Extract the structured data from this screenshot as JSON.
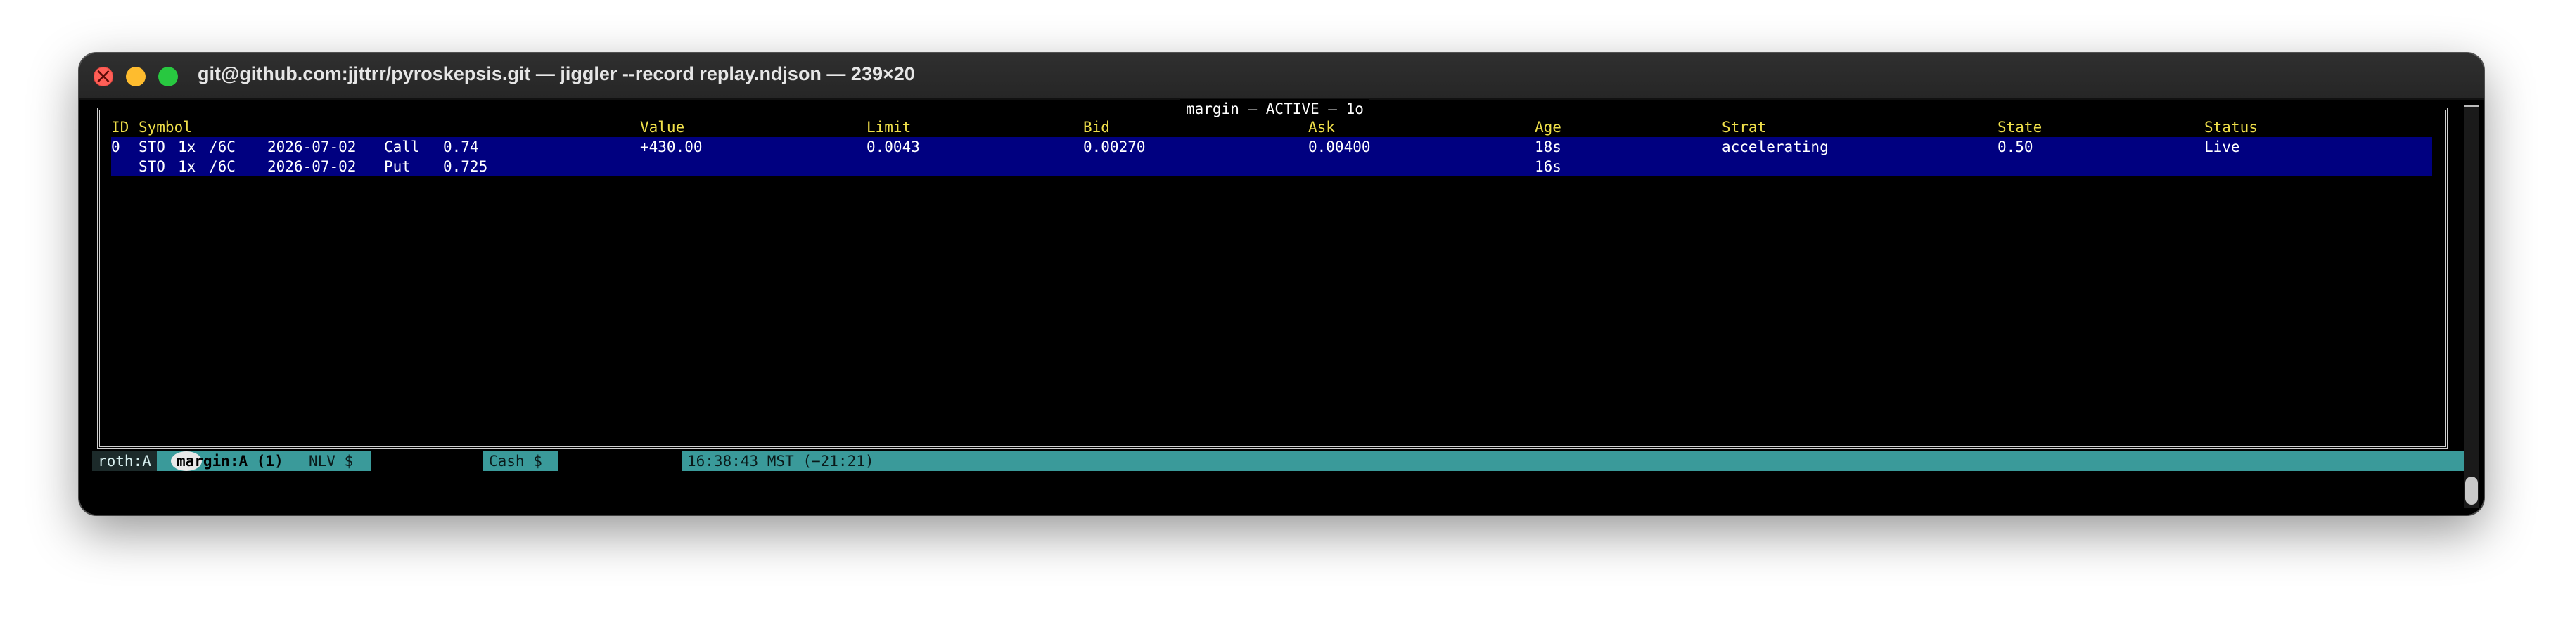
{
  "window": {
    "title": "git@github.com:jjttrr/pyroskepsis.git — jiggler --record replay.ndjson — 239×20"
  },
  "panel": {
    "title": "margin — ACTIVE — 1o"
  },
  "table": {
    "headers": [
      "ID",
      "Symbol",
      "Value",
      "Limit",
      "Bid",
      "Ask",
      "Age",
      "Strat",
      "State",
      "Status"
    ],
    "rows": [
      {
        "id": "0",
        "side": "STO",
        "qty": "1x",
        "root": "/6C",
        "expiry": "2026-07-02",
        "type": "Call",
        "strike": "0.74",
        "value": "+430.00",
        "limit": "0.0043",
        "bid": "0.00270",
        "ask": "0.00400",
        "age": "18s",
        "strat": "accelerating",
        "state": "0.50",
        "status": "Live"
      },
      {
        "id": "",
        "side": "STO",
        "qty": "1x",
        "root": "/6C",
        "expiry": "2026-07-02",
        "type": "Put",
        "strike": "0.725",
        "value": "",
        "limit": "",
        "bid": "",
        "ask": "",
        "age": "16s",
        "strat": "",
        "state": "",
        "status": ""
      }
    ]
  },
  "statusbar": {
    "tab_roth": "roth:A",
    "tab_margin": "margin:A (1)",
    "nlv": "NLV $",
    "cash": "Cash $",
    "clock": "16:38:43 MST (−21:21)"
  },
  "colors": {
    "header_text": "#f0e04a",
    "selected_row": "#000080",
    "statusbar": "#3a9a9a"
  }
}
